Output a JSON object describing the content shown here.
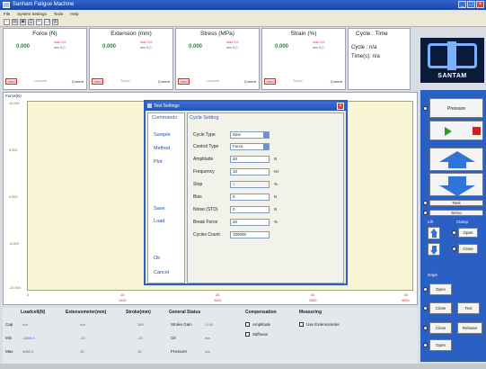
{
  "window": {
    "title": "Sanham Fatigue Machine"
  },
  "menu": [
    "File",
    "System Settings",
    "Tools",
    "Help"
  ],
  "toolbar": [
    "new-icon",
    "open-icon",
    "save-icon",
    "print-icon",
    "cut-icon",
    "copy-icon",
    "paste-icon"
  ],
  "readouts": [
    {
      "title": "Force (N)",
      "value": "0.000",
      "max": "max 0.0",
      "min": "min 0.0",
      "zero": "Zero",
      "mid": "Loadcell",
      "current": "Current"
    },
    {
      "title": "Extension (mm)",
      "value": "0.000",
      "max": "max 0.0",
      "min": "min 0.0",
      "zero": "Zero",
      "mid": "Stroke",
      "current": "Current"
    },
    {
      "title": "Stress (MPa)",
      "value": "0.000",
      "max": "max 0.0",
      "min": "min 0.0",
      "zero": "Zero",
      "mid": "Loadcell",
      "current": "Current"
    },
    {
      "title": "Strain (%)",
      "value": "0.000",
      "max": "max 0.0",
      "min": "min 0.0",
      "zero": "Zero",
      "mid": "Stroke",
      "current": "Current"
    }
  ],
  "cycletime": {
    "title": "Cycle : Time",
    "cycle": "Cycle : n/a",
    "time": "Time(s): n/a"
  },
  "logo": {
    "name": "SANTAM"
  },
  "chart": {
    "ylabel": "Force(N)",
    "yticks": [
      "10.000",
      "5.000",
      "0.000",
      "-5.000",
      "-10.000"
    ],
    "xticks_red": [
      "0",
      "10",
      "20",
      "30",
      "40"
    ],
    "xticks_red2": [
      "",
      "1000",
      "2000",
      "3000",
      "4000"
    ]
  },
  "dialog": {
    "title": "Test Settings",
    "commands_head": "Commands",
    "setting_head": "Cycle Setting",
    "links": [
      "Sample",
      "Method",
      "Plot",
      "Save",
      "Load",
      "Ok",
      "Cancel"
    ],
    "fields": [
      {
        "label": "Cycle Type",
        "value": "Sine",
        "unit": "",
        "kind": "select"
      },
      {
        "label": "Control Type",
        "value": "Force",
        "unit": "",
        "kind": "select"
      },
      {
        "label": "Amplitude",
        "value": "20",
        "unit": "N",
        "kind": "input"
      },
      {
        "label": "Frequency",
        "value": "10",
        "unit": "Hz",
        "kind": "input"
      },
      {
        "label": "Stop",
        "value": "0",
        "unit": "%",
        "kind": "disabled"
      },
      {
        "label": "Bias",
        "value": "0",
        "unit": "N",
        "kind": "input"
      },
      {
        "label": "Noise (STD)",
        "value": "0",
        "unit": "N",
        "kind": "input"
      },
      {
        "label": "Break Force",
        "value": "20",
        "unit": "%",
        "kind": "input"
      },
      {
        "label": "Cycles Count",
        "value": "100000",
        "unit": "",
        "kind": "input"
      }
    ]
  },
  "rpanel": {
    "pressure": "Pressure",
    "tank": "Tank",
    "servo": "Servo",
    "lift": "Lift",
    "clamp": "Clamp",
    "open": "Open",
    "close": "Close",
    "grips": "Grips",
    "test": "Test",
    "release": "Release"
  },
  "status": {
    "headers": [
      "Loadcell(N)",
      "Extensometer(mm)",
      "Stroke(mm)",
      "General Status",
      "Compensation",
      "Measuring"
    ],
    "rows": [
      "Cap",
      "Min",
      "Max"
    ],
    "loadcell": [
      "n/a",
      "-1000.0",
      "4000.0"
    ],
    "extensometer": [
      "n/a",
      "-10",
      "10"
    ],
    "stroke": [
      "100",
      "-15",
      "15"
    ],
    "general": [
      {
        "label": "Stroke Gain",
        "value": "-0.00"
      },
      {
        "label": "Oil",
        "value": "n/a"
      },
      {
        "label": "Pressure",
        "value": "n/a"
      }
    ],
    "compensation": [
      "Amplitude",
      "Stiffness"
    ],
    "measuring": [
      "Use Extensometer"
    ]
  },
  "colors": {
    "accent": "#2a5fc4",
    "plot_bg": "#f7f5d4",
    "value_green": "#2d8a2d"
  }
}
